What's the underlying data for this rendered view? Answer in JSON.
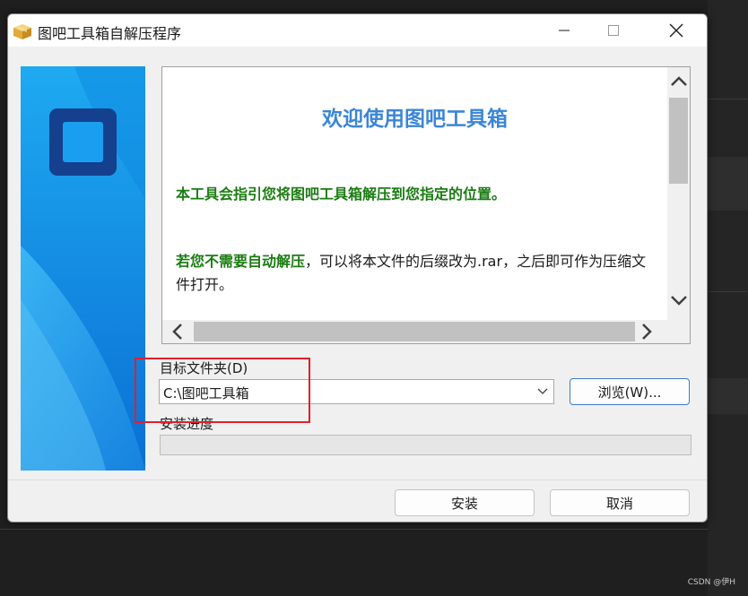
{
  "window": {
    "title": "图吧工具箱自解压程序"
  },
  "content": {
    "heading": "欢迎使用图吧工具箱",
    "intro": "本工具会指引您将图吧工具箱解压到您指定的位置。",
    "note_highlight": "若您不需要自动解压",
    "note_rest": "，可以将本文件的后缀改为.rar，之后即可作为压缩文件打开。"
  },
  "target": {
    "label": "目标文件夹(D)",
    "value": "C:\\图吧工具箱",
    "browse_label": "浏览(W)..."
  },
  "progress": {
    "label": "安装进度",
    "value": 0
  },
  "buttons": {
    "install": "安装",
    "cancel": "取消"
  },
  "watermark": "CSDN @伊H",
  "colors": {
    "heading": "#3b86d6",
    "highlight": "#1b7c12",
    "annotation": "#e0202a",
    "banner_top": "#1eaaf1",
    "banner_bottom": "#0a6fd4"
  },
  "icons": {
    "app": "package-icon",
    "minimize": "minimize-icon",
    "maximize": "maximize-icon",
    "close": "close-icon",
    "combo": "chevron-down-icon"
  }
}
